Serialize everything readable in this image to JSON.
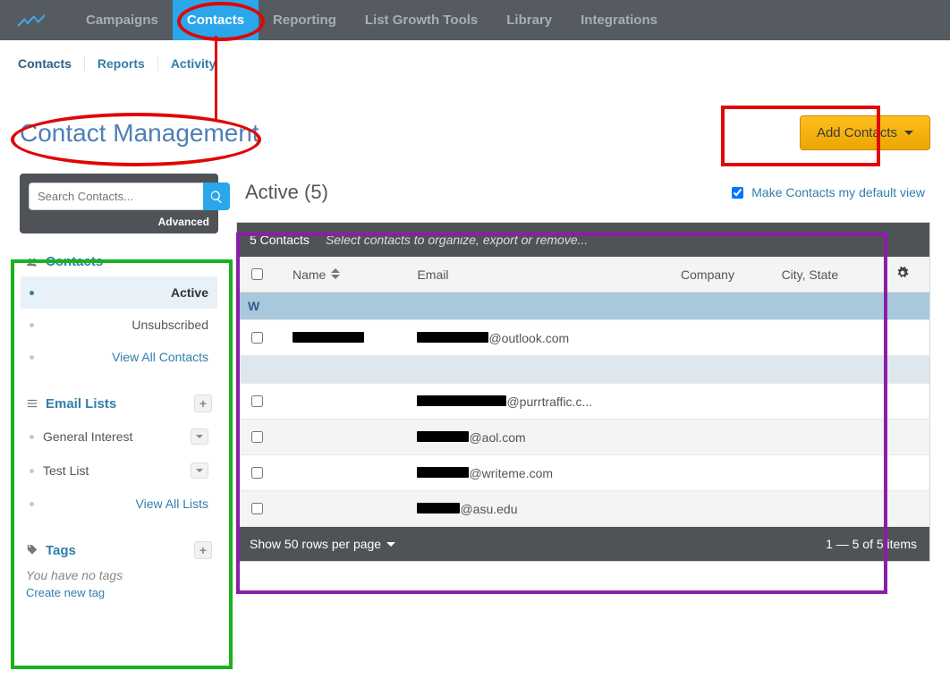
{
  "topnav": {
    "items": [
      "Campaigns",
      "Contacts",
      "Reporting",
      "List Growth Tools",
      "Library",
      "Integrations"
    ],
    "active_index": 1
  },
  "subnav": {
    "items": [
      "Contacts",
      "Reports",
      "Activity"
    ]
  },
  "page_title": "Contact Management",
  "add_contacts_label": "Add Contacts",
  "search": {
    "placeholder": "Search Contacts...",
    "advanced_label": "Advanced"
  },
  "sidebar": {
    "contacts": {
      "header": "Contacts",
      "items": [
        {
          "label": "Active",
          "active": true
        },
        {
          "label": "Unsubscribed"
        },
        {
          "label": "View All Contacts",
          "link": true
        }
      ]
    },
    "lists": {
      "header": "Email Lists",
      "items": [
        {
          "label": "General Interest",
          "drop": true
        },
        {
          "label": "Test List",
          "drop": true
        },
        {
          "label": "View All Lists",
          "link": true
        }
      ]
    },
    "tags": {
      "header": "Tags",
      "empty": "You have no tags",
      "create": "Create new tag"
    }
  },
  "main": {
    "title": "Active (5)",
    "default_view_label": "Make Contacts my default view",
    "default_view_checked": true,
    "info_count": "5 Contacts",
    "info_hint": "Select contacts to organize, export or remove...",
    "columns": [
      "Name",
      "Email",
      "Company",
      "City, State"
    ],
    "group_letter": "W",
    "rows": [
      {
        "name_redact": 80,
        "email_pre": 80,
        "email_suffix": "@outlook.com"
      },
      {
        "group_break": true
      },
      {
        "email_pre": 100,
        "email_suffix": "@purrtraffic.c..."
      },
      {
        "alt": true,
        "email_pre": 58,
        "email_suffix": "@aol.com"
      },
      {
        "email_pre": 58,
        "email_suffix": "@writeme.com"
      },
      {
        "alt": true,
        "email_pre": 48,
        "email_suffix": "@asu.edu"
      }
    ],
    "footer_rows": "Show 50 rows per page",
    "footer_count": "1 — 5 of 5 items"
  }
}
